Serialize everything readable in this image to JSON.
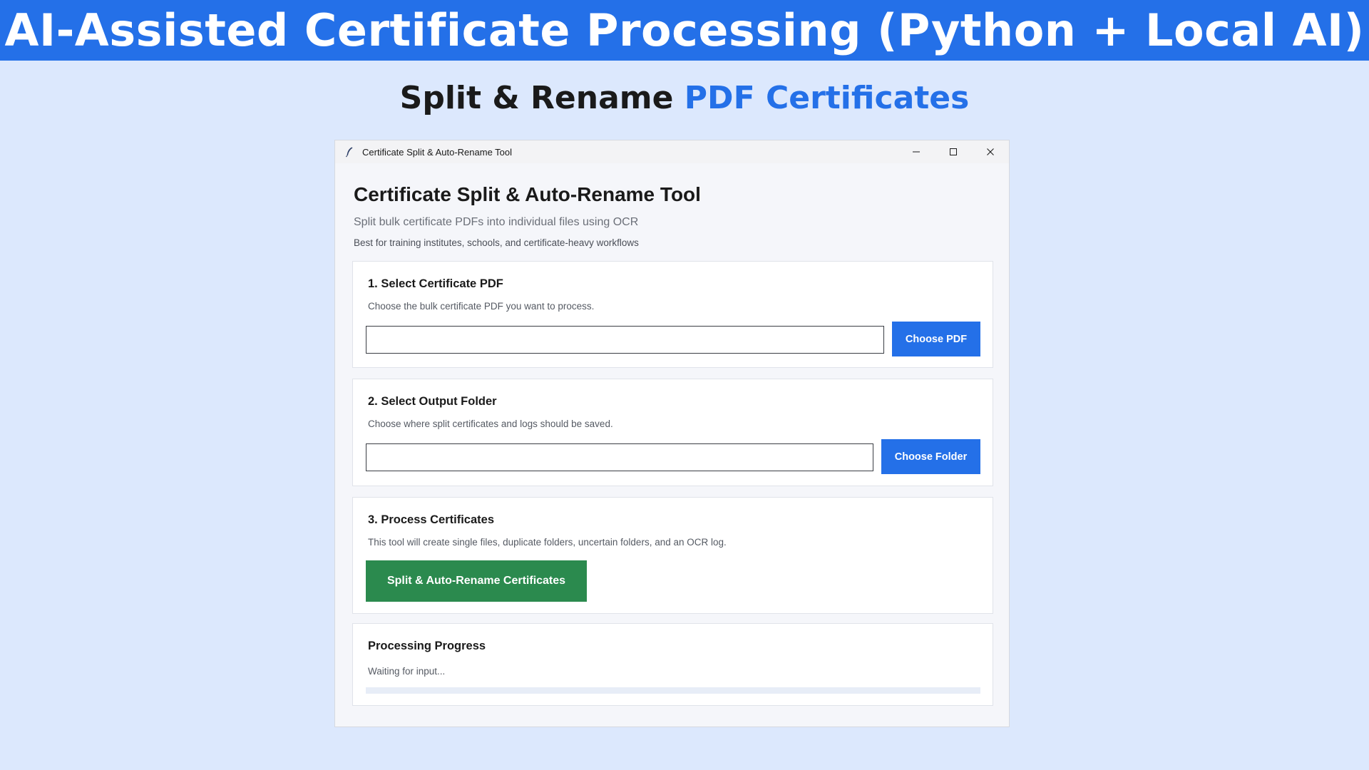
{
  "banner": {
    "title": "AI-Assisted Certificate Processing (Python + Local AI)"
  },
  "subtitle": {
    "part1": "Split & Rename ",
    "part2": "PDF Certificates"
  },
  "window": {
    "title": "Certificate Split & Auto-Rename Tool",
    "controls": [
      "minimize-icon",
      "maximize-icon",
      "close-icon"
    ]
  },
  "app": {
    "heading": "Certificate Split & Auto-Rename Tool",
    "description": "Split bulk certificate PDFs into individual files using OCR",
    "note": "Best for training institutes, schools, and certificate-heavy workflows"
  },
  "step1": {
    "title": "1. Select Certificate PDF",
    "description": "Choose the bulk certificate PDF you want to process.",
    "input_value": "",
    "button_label": "Choose PDF"
  },
  "step2": {
    "title": "2. Select Output Folder",
    "description": "Choose where split certificates and logs should be saved.",
    "input_value": "",
    "button_label": "Choose Folder"
  },
  "step3": {
    "title": "3. Process Certificates",
    "description": "This tool will create single files, duplicate folders, uncertain folders, and an OCR log.",
    "button_label": "Split & Auto-Rename Certificates"
  },
  "progress": {
    "title": "Processing Progress",
    "status": "Waiting for input...",
    "percent": 0
  },
  "colors": {
    "accent": "#2470e8",
    "success": "#2b8a4e",
    "background": "#dce8fd"
  }
}
